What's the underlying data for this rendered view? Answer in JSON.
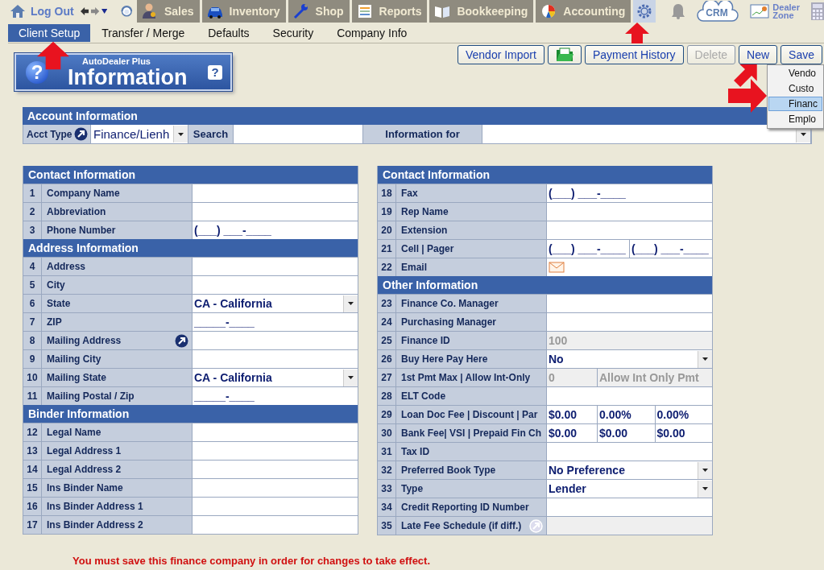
{
  "top_nav": {
    "logout": "Log Out",
    "tabs": [
      {
        "label": "Sales",
        "selected": false
      },
      {
        "label": "Inventory",
        "selected": false
      },
      {
        "label": "Shop",
        "selected": false
      },
      {
        "label": "Reports",
        "selected": false
      },
      {
        "label": "Bookkeeping",
        "selected": false
      },
      {
        "label": "Accounting",
        "selected": false
      },
      {
        "selected": true
      }
    ],
    "crm": "CRM",
    "dealer_zone": [
      "Dealer",
      "Zone"
    ]
  },
  "sub_nav": [
    {
      "label": "Client Setup",
      "selected": true
    },
    {
      "label": "Transfer / Merge",
      "selected": false
    },
    {
      "label": "Defaults",
      "selected": false
    },
    {
      "label": "Security",
      "selected": false
    },
    {
      "label": "Company Info",
      "selected": false
    }
  ],
  "header": {
    "brand": "AutoDealer Plus",
    "title": "Information",
    "badge": "?",
    "help": "?"
  },
  "toolbar": [
    {
      "kind": "text",
      "label": "Vendor Import",
      "disabled": false
    },
    {
      "kind": "folder",
      "disabled": false
    },
    {
      "kind": "text",
      "label": "Payment History",
      "disabled": false
    },
    {
      "kind": "text",
      "label": "Delete",
      "disabled": true
    },
    {
      "kind": "text",
      "label": "New",
      "disabled": false
    },
    {
      "kind": "text",
      "label": "Save",
      "disabled": false
    }
  ],
  "new_menu": [
    {
      "label": "Vendo",
      "selected": false
    },
    {
      "label": "Custo",
      "selected": false
    },
    {
      "label": "Financ",
      "selected": true
    },
    {
      "label": "Emplo",
      "selected": false
    }
  ],
  "account": {
    "title": "Account Information",
    "acct_type_label": "Acct Type",
    "acct_type": "Finance/Lienh",
    "search_label": "Search",
    "info_for_label": "Information for"
  },
  "left_column": [
    {
      "title": "Contact Information",
      "rows": [
        {
          "no": "1",
          "label": "Company Name",
          "kind": "text",
          "disabled": false
        },
        {
          "no": "2",
          "label": "Abbreviation",
          "kind": "text",
          "disabled": false
        },
        {
          "no": "3",
          "label": "Phone Number",
          "kind": "text",
          "value": "(___) ___-____",
          "disabled": false
        }
      ]
    },
    {
      "title": "Address Information",
      "rows": [
        {
          "no": "4",
          "label": "Address",
          "kind": "text",
          "disabled": false
        },
        {
          "no": "5",
          "label": "City",
          "kind": "text",
          "disabled": false
        },
        {
          "no": "6",
          "label": "State",
          "kind": "select",
          "value": "CA - California",
          "disabled": false
        },
        {
          "no": "7",
          "label": "ZIP",
          "kind": "text",
          "value": "_____-____",
          "disabled": false
        },
        {
          "no": "8",
          "label": "Mailing Address",
          "kind": "link",
          "disabled": false
        },
        {
          "no": "9",
          "label": "Mailing City",
          "kind": "text",
          "disabled": false
        },
        {
          "no": "10",
          "label": "Mailing State",
          "kind": "select",
          "value": "CA - California",
          "disabled": false
        },
        {
          "no": "11",
          "label": "Mailing Postal / Zip",
          "kind": "text",
          "value": "_____-____",
          "disabled": false
        }
      ]
    },
    {
      "title": "Binder Information",
      "rows": [
        {
          "no": "12",
          "label": "Legal Name",
          "kind": "text",
          "disabled": false
        },
        {
          "no": "13",
          "label": "Legal Address 1",
          "kind": "text",
          "disabled": false
        },
        {
          "no": "14",
          "label": "Legal Address 2",
          "kind": "text",
          "disabled": false
        },
        {
          "no": "15",
          "label": "Ins Binder Name",
          "kind": "text",
          "disabled": false
        },
        {
          "no": "16",
          "label": "Ins Binder Address 1",
          "kind": "text",
          "disabled": false
        },
        {
          "no": "17",
          "label": "Ins Binder Address 2",
          "kind": "text",
          "disabled": false
        }
      ]
    }
  ],
  "right_column": [
    {
      "title": "Contact Information",
      "rows": [
        {
          "no": "18",
          "label": "Fax",
          "kind": "text",
          "value": "(___) ___-____",
          "disabled": false
        },
        {
          "no": "19",
          "label": "Rep Name",
          "kind": "text",
          "disabled": false
        },
        {
          "no": "20",
          "label": "Extension",
          "kind": "text",
          "disabled": false
        },
        {
          "no": "21",
          "label": "Cell | Pager",
          "kind": "split",
          "values": [
            "(___) ___-____",
            "(___) ___-____"
          ],
          "disabled": false
        },
        {
          "no": "22",
          "label": "Email",
          "kind": "email",
          "disabled": false
        }
      ]
    },
    {
      "title": "Other Information",
      "rows": [
        {
          "no": "23",
          "label": "Finance Co. Manager",
          "kind": "text",
          "disabled": false
        },
        {
          "no": "24",
          "label": "Purchasing Manager",
          "kind": "text",
          "disabled": false
        },
        {
          "no": "25",
          "label": "Finance ID",
          "kind": "text",
          "value": "100",
          "disabled": true
        },
        {
          "no": "26",
          "label": "Buy Here Pay Here",
          "kind": "select",
          "value": "No",
          "disabled": false
        },
        {
          "no": "27",
          "label": "1st Pmt Max | Allow Int-Only",
          "kind": "split",
          "values": [
            "0",
            "Allow Int Only Pmt"
          ],
          "disabled": true
        },
        {
          "no": "28",
          "label": "ELT Code",
          "kind": "text",
          "disabled": false
        },
        {
          "no": "29",
          "label": "Loan Doc Fee | Discount | Par",
          "kind": "split",
          "values": [
            "$0.00",
            "0.00%",
            "0.00%"
          ],
          "disabled": false
        },
        {
          "no": "30",
          "label": "Bank Fee| VSI | Prepaid Fin Ch",
          "kind": "split",
          "values": [
            "$0.00",
            "$0.00",
            "$0.00"
          ],
          "disabled": false
        },
        {
          "no": "31",
          "label": "Tax ID",
          "kind": "text",
          "disabled": false
        },
        {
          "no": "32",
          "label": "Preferred Book Type",
          "kind": "select",
          "value": "No Preference",
          "disabled": false
        },
        {
          "no": "33",
          "label": "Type",
          "kind": "select",
          "value": "Lender",
          "disabled": false
        },
        {
          "no": "34",
          "label": "Credit Reporting ID Number",
          "kind": "text",
          "disabled": false
        },
        {
          "no": "35",
          "label": "Late Fee Schedule (if diff.)",
          "kind": "link",
          "disabled": true
        }
      ]
    }
  ],
  "message": "You must save this finance company in order for changes to take effect.",
  "callouts": [
    {
      "kind": "up"
    },
    {
      "kind": "up"
    },
    {
      "kind": "diagonal"
    },
    {
      "kind": "right"
    }
  ]
}
